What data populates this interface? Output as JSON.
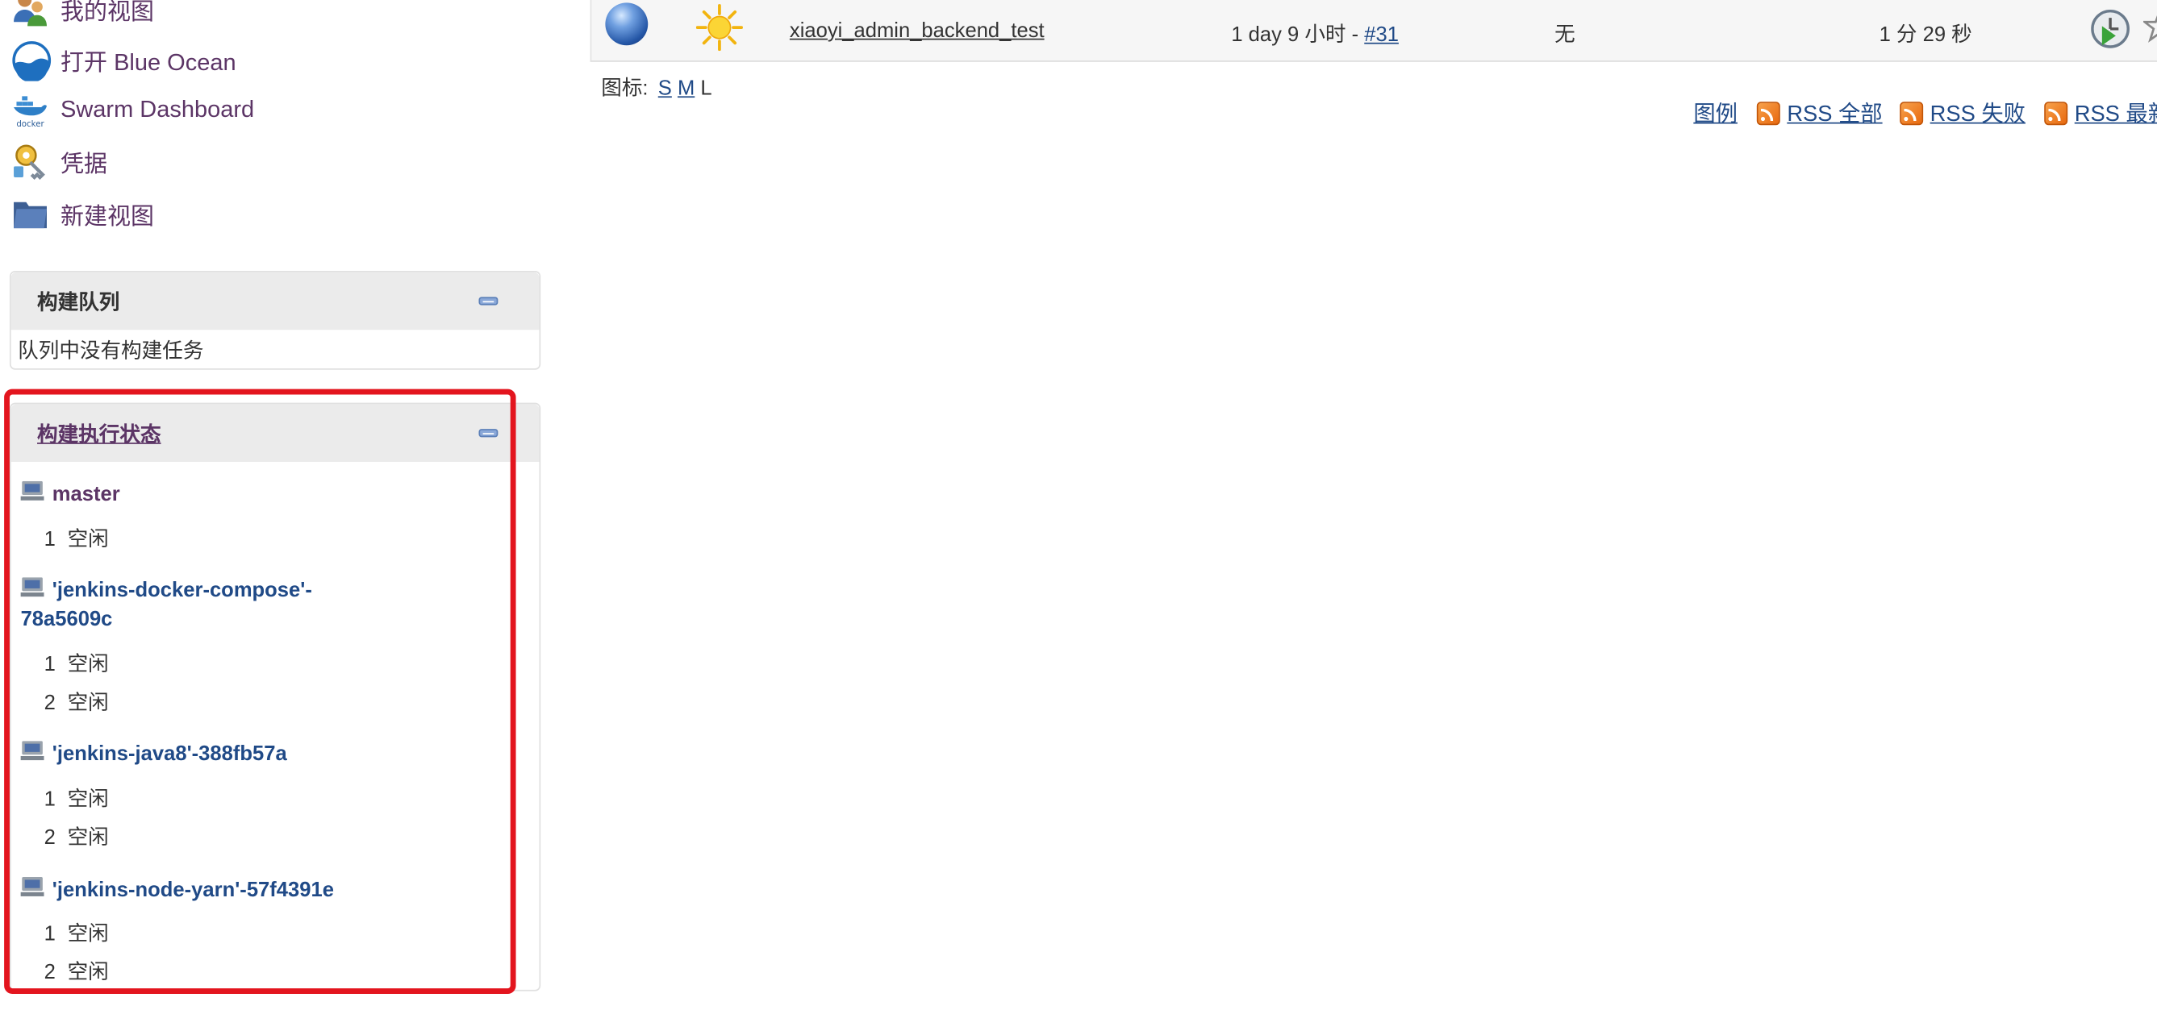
{
  "sidebar": {
    "tasks": [
      {
        "label": "我的视图",
        "icon": "user-view-icon"
      },
      {
        "label": "打开 Blue Ocean",
        "icon": "blue-ocean-icon"
      },
      {
        "label": "Swarm Dashboard",
        "icon": "docker-icon",
        "icon_text": "docker"
      },
      {
        "label": "凭据",
        "icon": "credentials-icon"
      },
      {
        "label": "新建视图",
        "icon": "folder-icon"
      }
    ]
  },
  "build_queue": {
    "title": "构建队列",
    "empty_text": "队列中没有构建任务"
  },
  "executors": {
    "title": "构建执行状态",
    "nodes": [
      {
        "name": "master",
        "executors": [
          {
            "num": "1",
            "status": "空闲"
          }
        ]
      },
      {
        "name_line1": "'jenkins-docker-compose'-",
        "name_line2": "78a5609c",
        "executors": [
          {
            "num": "1",
            "status": "空闲"
          },
          {
            "num": "2",
            "status": "空闲"
          }
        ]
      },
      {
        "name": "'jenkins-java8'-388fb57a",
        "executors": [
          {
            "num": "1",
            "status": "空闲"
          },
          {
            "num": "2",
            "status": "空闲"
          }
        ]
      },
      {
        "name": "'jenkins-node-yarn'-57f4391e",
        "executors": [
          {
            "num": "1",
            "status": "空闲"
          },
          {
            "num": "2",
            "status": "空闲"
          }
        ]
      }
    ]
  },
  "job": {
    "name": "xiaoyi_admin_backend_test",
    "last_success_prefix": "1 day 9 小时 - ",
    "last_success_build": "#31",
    "last_failure": "无",
    "last_duration": "1 分 29 秒",
    "status_color": "blue",
    "weather": "sunny"
  },
  "icon_sizes": {
    "label": "图标:",
    "s": "S",
    "m": "M",
    "l": "L"
  },
  "footer_links": {
    "legend": "图例",
    "rss_all": "RSS 全部",
    "rss_failed": "RSS 失败",
    "rss_latest": "RSS 最新"
  },
  "colors": {
    "highlight": "#e3151e",
    "link": "#204a87",
    "visited": "#5c3566"
  }
}
